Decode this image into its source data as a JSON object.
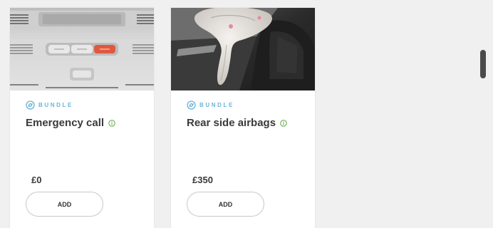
{
  "colors": {
    "bundle_accent": "#6ab3d9",
    "info_accent": "#5aa33c",
    "page_background": "#f0f0f0",
    "card_background": "#ffffff"
  },
  "cards": [
    {
      "image": "dashboard-overhead-console-photo",
      "bundle_label": "BUNDLE",
      "title": "Emergency call",
      "price": "£0",
      "button_label": "ADD"
    },
    {
      "image": "rear-side-airbag-deployed-photo",
      "bundle_label": "BUNDLE",
      "title": "Rear side airbags",
      "price": "£350",
      "button_label": "ADD"
    }
  ]
}
